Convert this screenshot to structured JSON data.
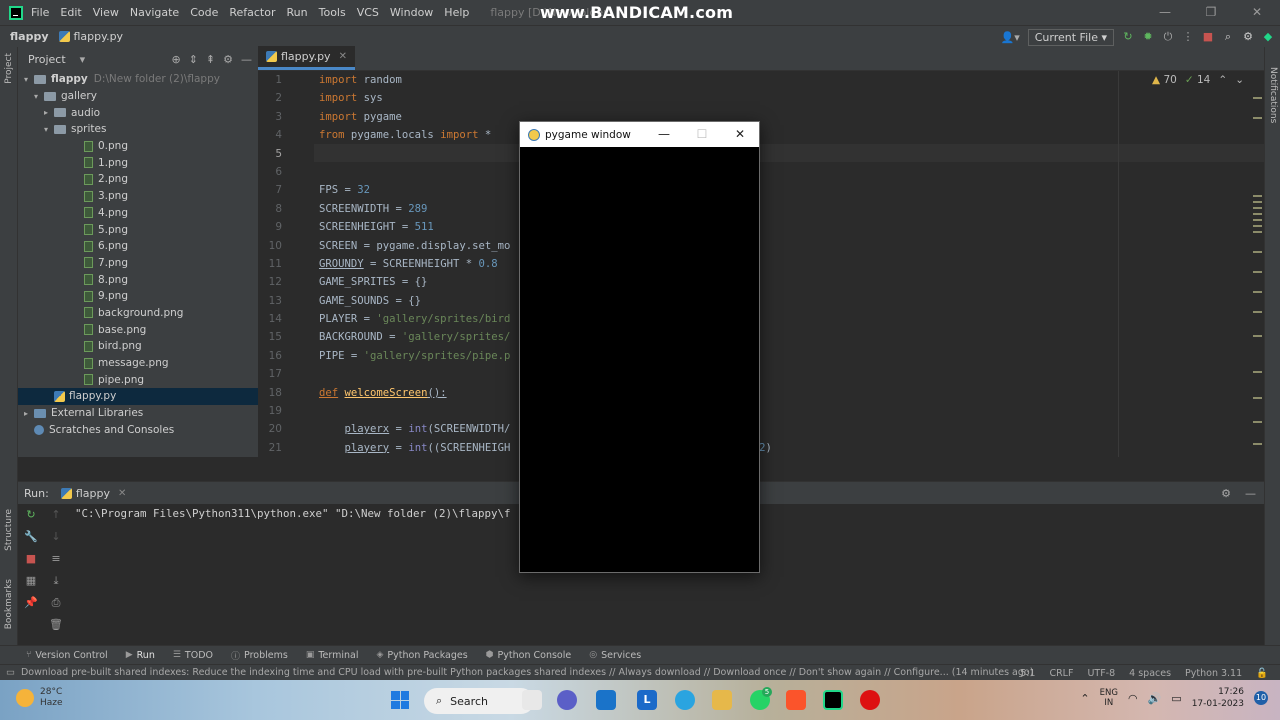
{
  "menu": [
    "File",
    "Edit",
    "View",
    "Navigate",
    "Code",
    "Refactor",
    "Run",
    "Tools",
    "VCS",
    "Window",
    "Help"
  ],
  "window_title": "flappy [D:\\New folder",
  "watermark": "www.BANDICAM.com",
  "nav": {
    "project": "flappy",
    "file": "flappy.py",
    "run_config": "Current File"
  },
  "project_panel": {
    "title": "Project",
    "root": "flappy",
    "root_path": "D:\\New folder (2)\\flappy",
    "tree": [
      {
        "label": "gallery",
        "type": "folder",
        "depth": 1
      },
      {
        "label": "audio",
        "type": "folder",
        "depth": 2
      },
      {
        "label": "sprites",
        "type": "folder",
        "depth": 2
      },
      {
        "label": "0.png",
        "type": "png",
        "depth": 3
      },
      {
        "label": "1.png",
        "type": "png",
        "depth": 3
      },
      {
        "label": "2.png",
        "type": "png",
        "depth": 3
      },
      {
        "label": "3.png",
        "type": "png",
        "depth": 3
      },
      {
        "label": "4.png",
        "type": "png",
        "depth": 3
      },
      {
        "label": "5.png",
        "type": "png",
        "depth": 3
      },
      {
        "label": "6.png",
        "type": "png",
        "depth": 3
      },
      {
        "label": "7.png",
        "type": "png",
        "depth": 3
      },
      {
        "label": "8.png",
        "type": "png",
        "depth": 3
      },
      {
        "label": "9.png",
        "type": "png",
        "depth": 3
      },
      {
        "label": "background.png",
        "type": "png",
        "depth": 3
      },
      {
        "label": "base.png",
        "type": "png",
        "depth": 3
      },
      {
        "label": "bird.png",
        "type": "png",
        "depth": 3
      },
      {
        "label": "message.png",
        "type": "png",
        "depth": 3
      },
      {
        "label": "pipe.png",
        "type": "png",
        "depth": 3
      }
    ],
    "selected_file": "flappy.py",
    "external_libraries": "External Libraries",
    "scratches": "Scratches and Consoles"
  },
  "editor": {
    "tab": "flappy.py",
    "warnings": "70",
    "weak_warnings": "14",
    "line_numbers": [
      "1",
      "2",
      "3",
      "4",
      "5",
      "6",
      "7",
      "8",
      "9",
      "10",
      "11",
      "12",
      "13",
      "14",
      "15",
      "16",
      "17",
      "18",
      "19",
      "20",
      "21"
    ]
  },
  "run_panel": {
    "label": "Run:",
    "tab": "flappy",
    "command": "\"C:\\Program Files\\Python311\\python.exe\" \"D:\\New folder (2)\\flappy\\f"
  },
  "tool_windows": [
    "Version Control",
    "Run",
    "TODO",
    "Problems",
    "Terminal",
    "Python Packages",
    "Python Console",
    "Services"
  ],
  "status": {
    "message": "Download pre-built shared indexes: Reduce the indexing time and CPU load with pre-built Python packages shared indexes // Always download // Download once // Don't show again // Configure... (14 minutes ago)",
    "position": "5:1",
    "line_sep": "CRLF",
    "encoding": "UTF-8",
    "indent": "4 spaces",
    "interpreter": "Python 3.11"
  },
  "taskbar": {
    "temp": "28°C",
    "weather": "Haze",
    "search": "Search",
    "lang1": "ENG",
    "lang2": "IN",
    "time": "17:26",
    "date": "17-01-2023",
    "notif": "10",
    "whatsapp_badge": "5"
  },
  "pygame_window": {
    "title": "pygame window"
  },
  "side_labels": {
    "project": "Project",
    "structure": "Structure",
    "bookmarks": "Bookmarks",
    "notifications": "Notifications"
  }
}
